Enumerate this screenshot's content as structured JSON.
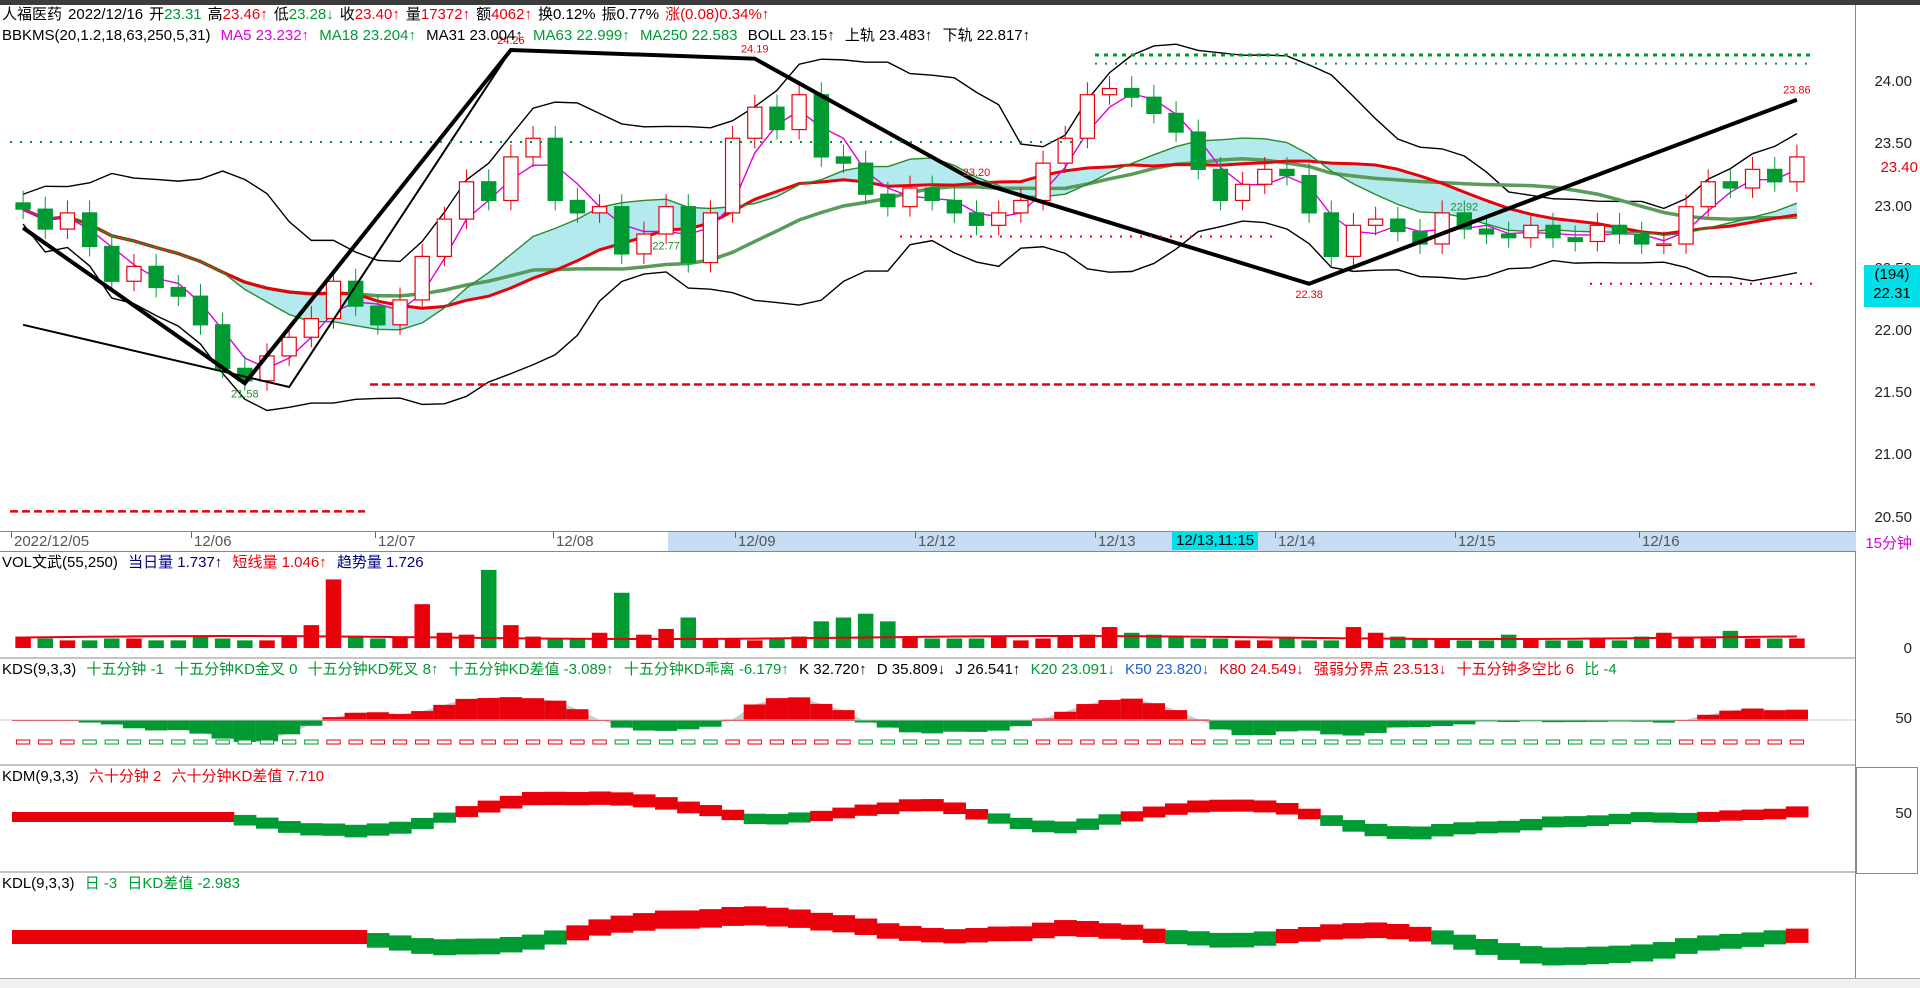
{
  "header": {
    "stock": "人福医药",
    "date": "2022/12/16",
    "open_label": "开",
    "open": "23.31",
    "high_label": "高",
    "high": "23.46↑",
    "low_label": "低",
    "low": "23.28↓",
    "close_label": "收",
    "close": "23.40↑",
    "vol_label": "量",
    "vol": "17372↑",
    "amt_label": "额",
    "amt": "4062↑",
    "turnover": "换0.12%",
    "amplitude": "振0.77%",
    "change": "涨(0.08)0.34%↑"
  },
  "main_indicator": {
    "name": "BBKMS(20,1.2,18,63,250,5,31)",
    "ma5": "MA5 23.232↑",
    "ma18": "MA18 23.204↑",
    "ma31": "MA31 23.004↑",
    "ma63": "MA63 22.999↑",
    "ma250": "MA250 22.583",
    "boll": "BOLL 23.15↑",
    "upper": "上轨 23.483↑",
    "lower": "下轨 22.817↑"
  },
  "price_axis": [
    "24.00",
    "23.50",
    "23.00",
    "22.50",
    "22.00",
    "21.50",
    "21.00",
    "20.50"
  ],
  "last_price": "23.40",
  "cursor_price_box": {
    "count": "(194)",
    "price": "22.31"
  },
  "date_axis": {
    "labels": [
      "2022/12/05",
      "12/06",
      "12/07",
      "12/08",
      "12/09",
      "12/12",
      "12/13",
      "12/14",
      "12/15",
      "12/16"
    ],
    "cursor": "12/13,11:15",
    "period": "15分钟"
  },
  "annotations": [
    "21.58",
    "24.26",
    "24.19",
    "22.77",
    "23.20",
    "22.38",
    "22.92",
    "23.86"
  ],
  "vol_panel": {
    "name": "VOL文武(55,250)",
    "today": "当日量 1.737↑",
    "short": "短线量 1.046↑",
    "trend": "趋势量 1.726",
    "axis0": "0"
  },
  "kds_panel": {
    "name": "KDS(9,3,3)",
    "items": [
      "十五分钟 -1",
      "十五分钟KD金叉 0",
      "十五分钟KD死叉 8↑",
      "十五分钟KD差值 -3.089↑",
      "十五分钟KD乖离 -6.179↑"
    ],
    "k": "K 32.720↑",
    "d": "D 35.809↓",
    "j": "J 26.541↑",
    "k20": "K20 23.091↓",
    "k50": "K50 23.820↓",
    "k80": "K80 24.549↓",
    "weak": "强弱分界点 23.513↓",
    "ratio": "十五分钟多空比 6",
    "bi": "比 -4",
    "axis50": "50"
  },
  "kdm_panel": {
    "name": "KDM(9,3,3)",
    "items": [
      "六十分钟 2",
      "六十分钟KD差值 7.710"
    ],
    "axis50": "50"
  },
  "kdl_panel": {
    "name": "KDL(9,3,3)",
    "items": [
      "日 -3",
      "日KD差值 -2.983"
    ]
  },
  "colors": {
    "up": "#e8000b",
    "down": "#009a33",
    "ma5": "#e000e0",
    "ma250": "#e8000b",
    "band_fill": "#a6e6ea",
    "green_fill": "#8fe08a",
    "cursor": "#00e0e8"
  },
  "chart_data": {
    "type": "candlestick",
    "title": "人福医药 15分钟",
    "x": [
      "2022/12/05",
      "12/06",
      "12/07",
      "12/08",
      "12/09",
      "12/12",
      "12/13",
      "12/14",
      "12/15",
      "12/16"
    ],
    "ylim": [
      20.4,
      24.3
    ],
    "close": [
      22.98,
      22.82,
      22.95,
      22.68,
      22.4,
      22.52,
      22.35,
      22.28,
      22.05,
      21.7,
      21.6,
      21.8,
      21.95,
      22.1,
      22.4,
      22.2,
      22.05,
      22.25,
      22.6,
      22.9,
      23.2,
      23.05,
      23.4,
      23.55,
      23.05,
      22.95,
      23.0,
      22.62,
      22.78,
      23.0,
      22.55,
      22.95,
      23.55,
      23.8,
      23.62,
      23.9,
      23.4,
      23.35,
      23.1,
      23.0,
      23.15,
      23.05,
      22.95,
      22.85,
      22.95,
      23.05,
      23.35,
      23.55,
      23.9,
      23.95,
      23.88,
      23.75,
      23.6,
      23.3,
      23.05,
      23.18,
      23.3,
      23.25,
      22.95,
      22.6,
      22.85,
      22.9,
      22.8,
      22.7,
      22.95,
      22.82,
      22.78,
      22.75,
      22.85,
      22.75,
      22.72,
      22.85,
      22.78,
      22.7,
      22.7,
      23.0,
      23.2,
      23.15,
      23.3,
      23.2,
      23.4
    ],
    "volume": [
      0.6,
      0.5,
      0.4,
      0.4,
      0.5,
      0.5,
      0.4,
      0.4,
      0.6,
      0.5,
      0.4,
      0.4,
      0.6,
      1.2,
      3.6,
      0.6,
      0.5,
      0.6,
      2.3,
      0.8,
      0.7,
      4.1,
      1.2,
      0.6,
      0.5,
      0.5,
      0.8,
      2.9,
      0.7,
      1.0,
      1.6,
      0.5,
      0.5,
      0.4,
      0.5,
      0.6,
      1.4,
      1.6,
      1.8,
      1.4,
      0.6,
      0.5,
      0.5,
      0.5,
      0.6,
      0.4,
      0.5,
      0.6,
      0.7,
      1.1,
      0.8,
      0.7,
      0.6,
      0.5,
      0.5,
      0.4,
      0.4,
      0.5,
      0.4,
      0.4,
      1.1,
      0.8,
      0.6,
      0.5,
      0.5,
      0.4,
      0.4,
      0.7,
      0.5,
      0.4,
      0.4,
      0.5,
      0.4,
      0.6,
      0.8,
      0.6,
      0.5,
      0.9,
      0.5,
      0.5,
      0.5
    ]
  }
}
